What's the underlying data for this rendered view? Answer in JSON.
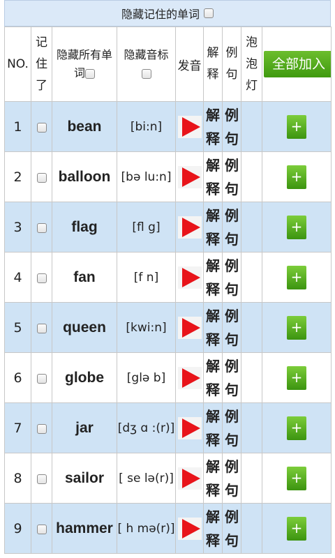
{
  "header": {
    "hide_remembered_label": "隐藏记住的单词"
  },
  "columns": {
    "no": "NO.",
    "remembered": [
      "记",
      "住",
      "了"
    ],
    "hide_words_line1": "隐藏所有单",
    "hide_words_line2": "词",
    "hide_phonetic": "隐藏音标",
    "pronounce": "发音",
    "explain": [
      "解",
      "释"
    ],
    "example": [
      "例",
      "句"
    ],
    "bubble": [
      "泡",
      "泡",
      "灯"
    ],
    "add_all": "全部加入"
  },
  "rows": [
    {
      "no": "1",
      "word": "bean",
      "phonetic": "[bi:n]"
    },
    {
      "no": "2",
      "word": "balloon",
      "phonetic": "[bə lu:n]"
    },
    {
      "no": "3",
      "word": "flag",
      "phonetic": "[fl g]"
    },
    {
      "no": "4",
      "word": "fan",
      "phonetic": "[f n]"
    },
    {
      "no": "5",
      "word": "queen",
      "phonetic": "[kwi:n]"
    },
    {
      "no": "6",
      "word": "globe",
      "phonetic": "[glə b]"
    },
    {
      "no": "7",
      "word": "jar",
      "phonetic": "[dʒ ɑ :(r)]"
    },
    {
      "no": "8",
      "word": "sailor",
      "phonetic": "[ se lə(r)]"
    },
    {
      "no": "9",
      "word": "hammer",
      "phonetic": "[ h mə(r)]"
    }
  ],
  "row_labels": {
    "explain": [
      "解",
      "释"
    ],
    "example": [
      "例",
      "句"
    ],
    "add": "+"
  },
  "colors": {
    "row_alt": "#cfe3f5",
    "add_green": "#4fa81c",
    "play_red": "#e8141a"
  }
}
